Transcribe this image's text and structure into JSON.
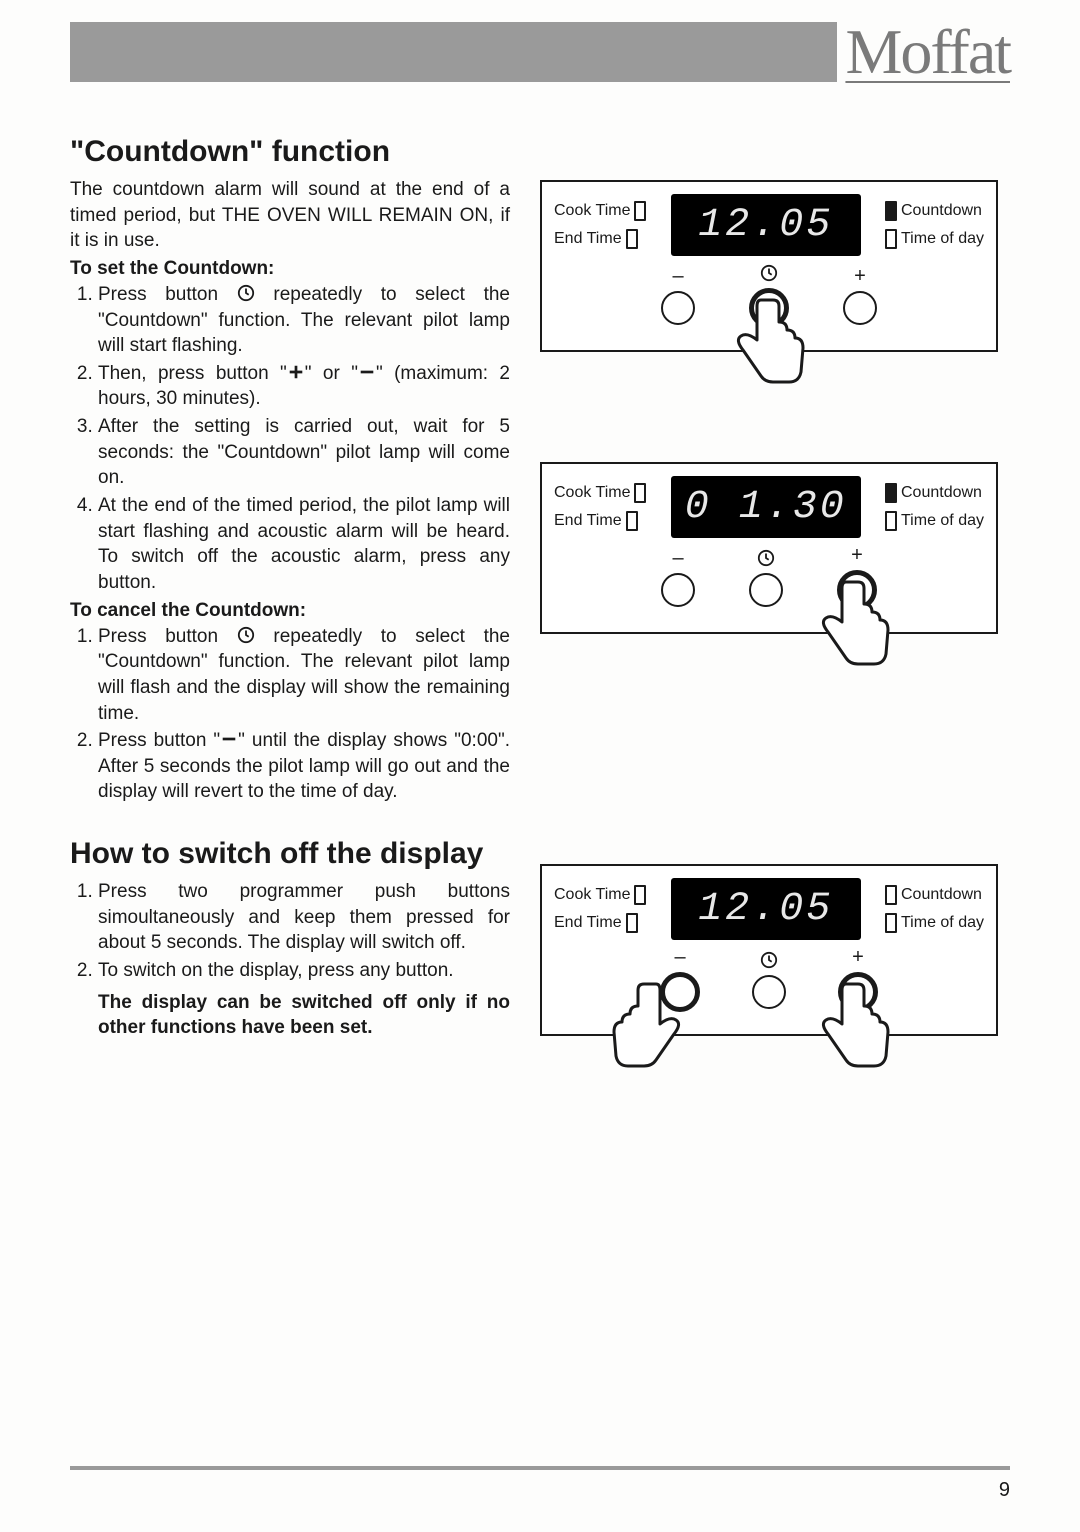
{
  "brand": "Moffat",
  "page_number": "9",
  "section1": {
    "title": "\"Countdown\" function",
    "intro": "The countdown alarm will sound at the end of a timed period, but THE OVEN WILL REMAIN ON, if it is in use.",
    "set_head": "To set the Countdown:",
    "set_steps": [
      "Press button         repeatedly to select  the \"Countdown\" function. The relevant pilot lamp will start flashing.",
      "Then, press button \"      \" or \"      \" (maximum: 2 hours, 30 minutes).",
      "After the setting is carried out, wait for 5 seconds: the \"Countdown\" pilot lamp will come on.",
      "At the end of the timed period, the pilot lamp will start flashing and acoustic alarm will be heard. To switch off the acoustic alarm, press any button."
    ],
    "cancel_head": "To cancel the Countdown:",
    "cancel_steps": [
      "Press button        repeatedly to select  the \"Countdown\" function. The relevant pilot lamp will  flash and the display will show the remaining time.",
      "Press button \"       \" until the display shows \"0:00\". After 5 seconds the pilot lamp will go out and the display will revert to the time of day."
    ]
  },
  "section2": {
    "title": "How to switch off the display",
    "steps": [
      "Press two programmer push buttons simoultaneously  and keep them pressed for about 5 seconds. The display will switch off.",
      "To switch on the display, press any button."
    ],
    "note": "The display can be switched off only if no other functions have been set."
  },
  "panel_labels": {
    "cook_time": "Cook Time",
    "end_time": "End Time",
    "countdown": "Countdown",
    "time_of_day": "Time of day",
    "minus": "–",
    "plus": "+"
  },
  "panels": [
    {
      "time": "12.05",
      "press": "center",
      "countdown_on": true,
      "hands": [
        "center"
      ]
    },
    {
      "time": "0 1.30",
      "press": "plus",
      "countdown_on": true,
      "hands": [
        "plus"
      ]
    },
    {
      "time": "12.05",
      "press": "both",
      "countdown_on": false,
      "hands": [
        "minus",
        "plus"
      ]
    }
  ]
}
